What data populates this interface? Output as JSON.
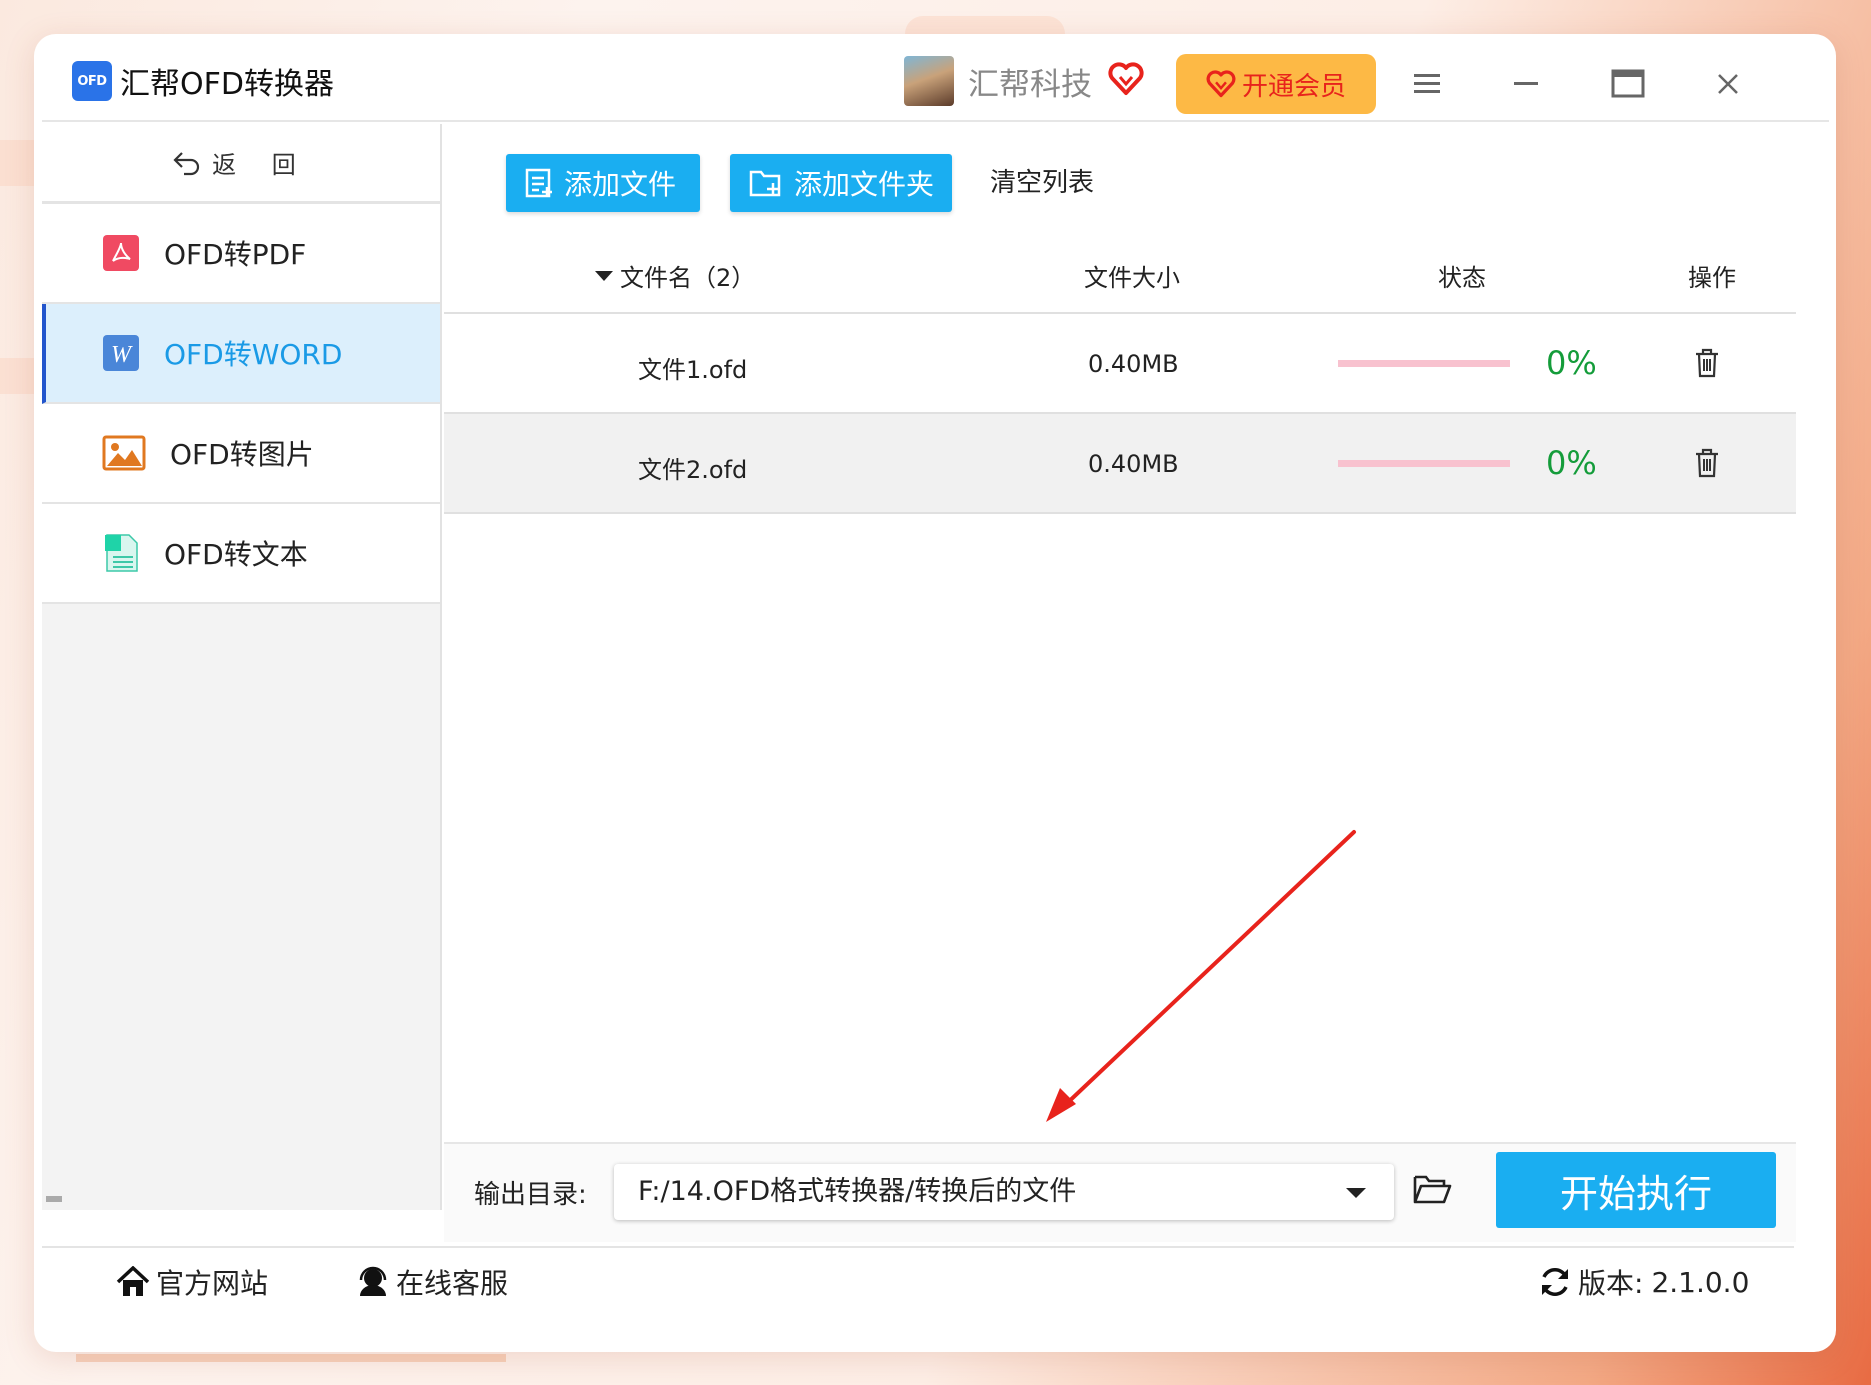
{
  "app": {
    "title": "汇帮OFD转换器",
    "logo_text": "OFD"
  },
  "user": {
    "name": "汇帮科技"
  },
  "header": {
    "vip_label": "开通会员"
  },
  "sidebar": {
    "back_label": "返 回",
    "items": [
      {
        "label": "OFD转PDF",
        "icon": "pdf-icon",
        "active": false
      },
      {
        "label": "OFD转WORD",
        "icon": "word-icon",
        "active": true
      },
      {
        "label": "OFD转图片",
        "icon": "image-icon",
        "active": false
      },
      {
        "label": "OFD转文本",
        "icon": "text-file-icon",
        "active": false
      }
    ]
  },
  "toolbar": {
    "add_file_label": "添加文件",
    "add_folder_label": "添加文件夹",
    "clear_label": "清空列表"
  },
  "table": {
    "columns": [
      "文件名（2）",
      "文件大小",
      "状态",
      "操作"
    ],
    "rows": [
      {
        "name": "文件1.ofd",
        "size": "0.40MB",
        "progress": 0,
        "progress_text": "0%"
      },
      {
        "name": "文件2.ofd",
        "size": "0.40MB",
        "progress": 0,
        "progress_text": "0%"
      }
    ]
  },
  "output": {
    "label": "输出目录:",
    "path": "F:/14.OFD格式转换器/转换后的文件",
    "start_label": "开始执行"
  },
  "statusbar": {
    "website_label": "官方网站",
    "support_label": "在线客服",
    "version_label": "版本:",
    "version": "2.1.0.0"
  },
  "colors": {
    "accent": "#1aaef1",
    "progress_green": "#149c3a",
    "vip_bg": "#fdb945",
    "active_nav": "#dceffc"
  }
}
